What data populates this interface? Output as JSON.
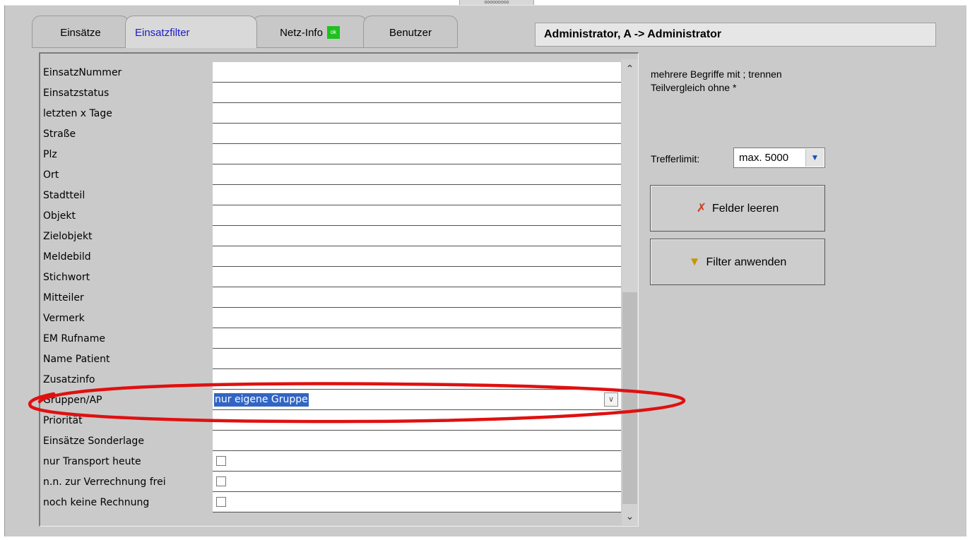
{
  "window": {
    "grip_text": "ooooooooo"
  },
  "tabs": [
    {
      "label": "Einsätze"
    },
    {
      "label": "Einsatzfilter"
    },
    {
      "label": "Netz-Info",
      "badge": "ok"
    },
    {
      "label": "Benutzer"
    }
  ],
  "active_tab": "Einsatzfilter",
  "user_display": "Administrator, A -> Administrator",
  "filter_fields": [
    {
      "label": "EinsatzNummer",
      "value": ""
    },
    {
      "label": "Einsatzstatus",
      "value": ""
    },
    {
      "label": "letzten x Tage",
      "value": ""
    },
    {
      "label": "Straße",
      "value": ""
    },
    {
      "label": "Plz",
      "value": ""
    },
    {
      "label": "Ort",
      "value": ""
    },
    {
      "label": "Stadtteil",
      "value": ""
    },
    {
      "label": "Objekt",
      "value": ""
    },
    {
      "label": "Zielobjekt",
      "value": ""
    },
    {
      "label": "Meldebild",
      "value": ""
    },
    {
      "label": "Stichwort",
      "value": ""
    },
    {
      "label": "Mitteiler",
      "value": ""
    },
    {
      "label": "Vermerk",
      "value": ""
    },
    {
      "label": "EM Rufname",
      "value": ""
    },
    {
      "label": "Name Patient",
      "value": ""
    },
    {
      "label": "Zusatzinfo",
      "value": ""
    },
    {
      "label": "Gruppen/AP",
      "value": "nur eigene Gruppe"
    },
    {
      "label": "Priorität",
      "value": ""
    },
    {
      "label": "Einsätze Sonderlage",
      "value": ""
    },
    {
      "label": "nur Transport heute",
      "checked": false
    },
    {
      "label": "n.n. zur Verrechnung frei",
      "checked": false
    },
    {
      "label": "noch keine Rechnung",
      "checked": false
    }
  ],
  "hints": {
    "line1": "mehrere Begriffe mit ; trennen",
    "line2": "Teilvergleich ohne *"
  },
  "limit": {
    "label": "Trefferlimit:",
    "value": "max. 5000"
  },
  "buttons": {
    "clear": "Felder leeren",
    "apply": "Filter anwenden"
  },
  "colors": {
    "background": "#cacaca",
    "active_tab_text": "#1c1cc8",
    "selection": "#3165c4",
    "annotation": "#e01010",
    "ok_badge": "#1fc01f"
  }
}
